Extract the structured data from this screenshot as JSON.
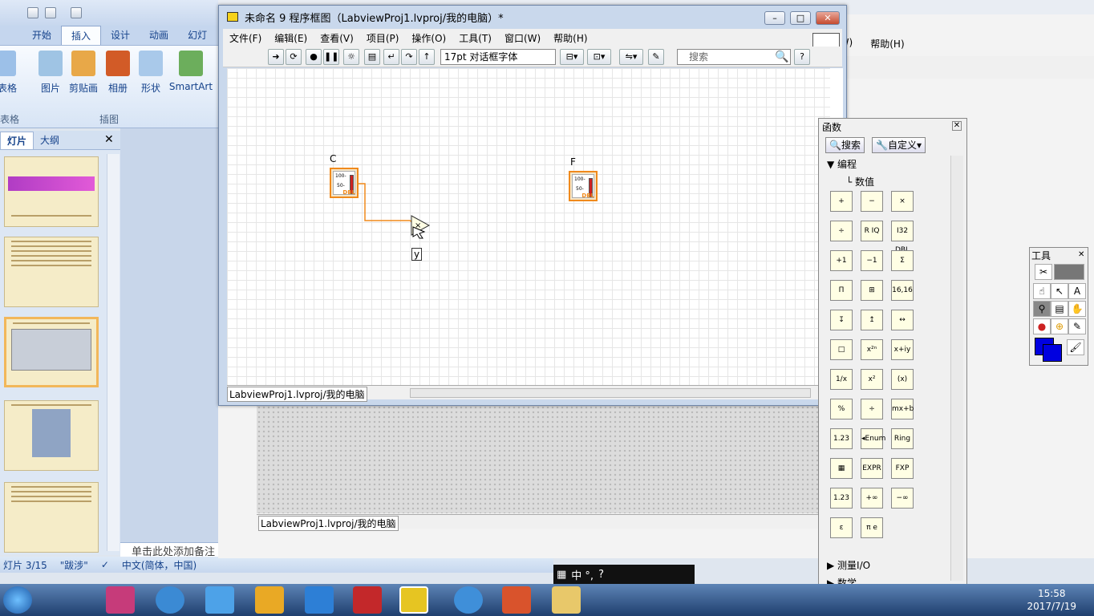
{
  "ppt": {
    "tabs": [
      "开始",
      "插入",
      "设计",
      "动画",
      "幻灯"
    ],
    "ribbon": {
      "table": "表格",
      "picture": "图片",
      "clipart": "剪贴画",
      "album": "相册",
      "shapes": "形状",
      "smartart": "SmartArt",
      "table_group": "表格",
      "group": "插图"
    },
    "pane_tabs": [
      "灯片",
      "大纲"
    ],
    "notes_placeholder": "单击此处添加备注",
    "status": {
      "slide": "灯片 3/15",
      "theme": "\"跋涉\"",
      "lang": "中文(简体，中国)"
    }
  },
  "bg_window": {
    "menu": [
      "(W)",
      "帮助(H)"
    ],
    "path": "LabviewProj1.lvproj/我的电脑"
  },
  "block_diagram": {
    "title": "未命名 9 程序框图（LabviewProj1.lvproj/我的电脑）*",
    "menu": [
      "文件(F)",
      "编辑(E)",
      "查看(V)",
      "项目(P)",
      "操作(O)",
      "工具(T)",
      "窗口(W)",
      "帮助(H)"
    ],
    "font": "17pt 对话框字体",
    "search_placeholder": "搜索",
    "terminals": {
      "c": "C",
      "f": "F",
      "y": "y",
      "dbl": "DBL"
    },
    "path": "LabviewProj1.lvproj/我的电脑"
  },
  "functions_palette": {
    "title": "函数",
    "search_btn": "搜索",
    "custom_btn": "自定义▾",
    "tree": [
      "编程",
      "数值"
    ],
    "bottom": [
      "测量I/O",
      "数学"
    ],
    "items": [
      "+",
      "−",
      "×",
      "÷",
      "R IQ",
      "I32 DBL",
      "+1",
      "−1",
      "Σ",
      "Π",
      "⊞",
      "16,16",
      "↧",
      "↥",
      "↔",
      "□",
      "x²ⁿ",
      "x+iy",
      "1/x",
      "x²",
      "(x)",
      "%",
      "÷",
      "mx+b",
      "1.23",
      "◂Enum",
      "Ring",
      "▦",
      "EXPR",
      "FXP",
      "1.23",
      "+∞",
      "−∞",
      "ε",
      "π e"
    ]
  },
  "tools_palette": {
    "title": "工具"
  },
  "ime": {
    "label": "中 °,"
  },
  "taskbar": {
    "time": "15:58",
    "date": "2017/7/19"
  },
  "colors": {
    "wire": "#f08a1c",
    "accent": "#c54a2f",
    "ribbon": "#15428b"
  }
}
